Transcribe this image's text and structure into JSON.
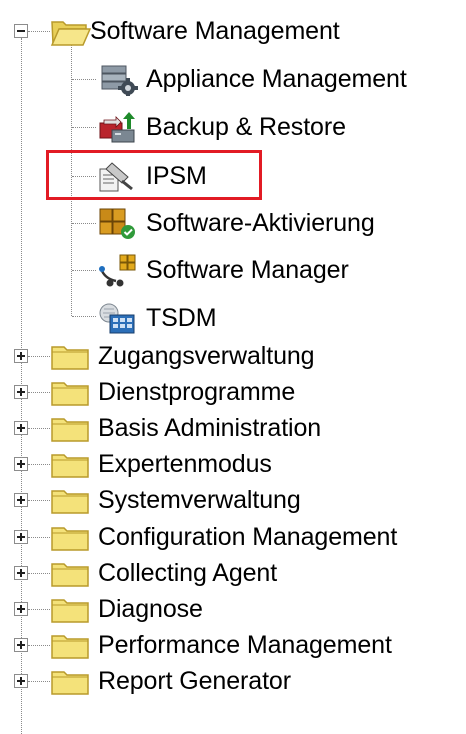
{
  "tree": {
    "root": {
      "label": "Software Management",
      "state": "expanded",
      "icon": "folder-open-icon",
      "children": [
        {
          "label": "Appliance Management",
          "icon": "server-gear-icon"
        },
        {
          "label": "Backup & Restore",
          "icon": "backup-restore-icon"
        },
        {
          "label": "IPSM",
          "icon": "document-stamp-icon",
          "highlighted": true
        },
        {
          "label": "Software-Aktivierung",
          "icon": "software-activation-icon"
        },
        {
          "label": "Software Manager",
          "icon": "software-manager-icon"
        },
        {
          "label": "TSDM",
          "icon": "tsdm-icon"
        }
      ]
    },
    "folders": [
      {
        "label": "Zugangsverwaltung",
        "state": "collapsed",
        "icon": "folder-icon"
      },
      {
        "label": "Dienstprogramme",
        "state": "collapsed",
        "icon": "folder-icon"
      },
      {
        "label": "Basis Administration",
        "state": "collapsed",
        "icon": "folder-icon"
      },
      {
        "label": "Expertenmodus",
        "state": "collapsed",
        "icon": "folder-icon"
      },
      {
        "label": "Systemverwaltung",
        "state": "collapsed",
        "icon": "folder-icon"
      },
      {
        "label": "Configuration Management",
        "state": "collapsed",
        "icon": "folder-icon"
      },
      {
        "label": "Collecting Agent",
        "state": "collapsed",
        "icon": "folder-icon"
      },
      {
        "label": "Diagnose",
        "state": "collapsed",
        "icon": "folder-icon"
      },
      {
        "label": "Performance Management",
        "state": "collapsed",
        "icon": "folder-icon"
      },
      {
        "label": "Report Generator",
        "state": "collapsed",
        "icon": "folder-icon"
      }
    ]
  },
  "colors": {
    "folder_fill": "#f4e27a",
    "folder_edge": "#b89a2b",
    "highlight": "#e21b24",
    "tree_line": "#8a8a8a"
  }
}
